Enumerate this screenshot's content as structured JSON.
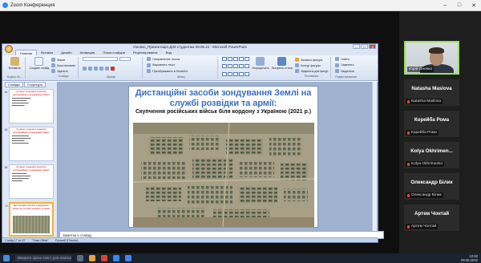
{
  "zoom": {
    "window_title": "Zoom Конференция"
  },
  "ppt": {
    "title": "Онопко_Презентація ДЗЗ студентам 09.06.22 - Microsoft PowerPoint",
    "tabs": [
      "Главная",
      "Вставка",
      "Дизайн",
      "Анимация",
      "Показ слайдов",
      "Рецензирование",
      "Вид"
    ],
    "ribbon": {
      "paste": "Вставить",
      "new_slide": "Создать слайд",
      "layout": "Макет",
      "reset": "Восстановить",
      "delete": "Удалить",
      "clipboard": "Буфер об...",
      "slides": "Слайды",
      "font": "Шрифт",
      "paragraph": "Абзац",
      "text_direction": "Направление текста",
      "align_text": "Выровнять текст",
      "smartart": "Преобразовать в SmartArt",
      "arrange": "Упорядочить",
      "quick_styles": "Экспресс-стили",
      "shape_fill": "Заливка фигуры",
      "shape_outline": "Контур фигуры",
      "shape_effects": "Эффекты для фигур",
      "drawing": "Рисование",
      "find": "Найти",
      "replace": "Заменить",
      "select": "Выделить",
      "editing": "Редактирование"
    },
    "pane_tabs": [
      "Слайды",
      "Структура"
    ],
    "thumbs": [
      {
        "num": "14",
        "title": "Сучасні тенденції розвитку дистанційного зондування Землі"
      },
      {
        "num": "15",
        "title": "Сучасні тенденції розвитку дистанційного зондування Землі"
      },
      {
        "num": "16",
        "title": "Сучасні тенденції розвитку дистанційного зондування Землі"
      },
      {
        "num": "17",
        "title": "Дистанційні засоби зондування Землі на службі розвідки та армії"
      }
    ],
    "slide": {
      "title": "Дистанційні засоби зондування Землі на службі розвідки та армії:",
      "subtitle": "Скупчення російських військ біля кордону з Україною (2021 р.)"
    },
    "notes": "Заметки к слайду",
    "status": {
      "slide": "Слайд 17 из 57",
      "theme": "\"Тема Office\"",
      "lang": "Русский (Россия)"
    }
  },
  "participants": {
    "active_speaker": "Юрій Онопко",
    "tiles": [
      {
        "name": "Natasha Maslova",
        "label": "Natasha Maslova"
      },
      {
        "name": "Корейба Рома",
        "label": "Корейба Рома"
      },
      {
        "name": "Kolya Okhrimen...",
        "label": "Kolya Okhrimenko"
      },
      {
        "name": "Олександр Білик",
        "label": "Олександр Білик"
      },
      {
        "name": "Артем Чонтай",
        "label": "Артем Чонтай"
      }
    ]
  },
  "taskbar": {
    "search": "Введите здесь текст для поиска",
    "time": "10:50",
    "date": "09.06.2022"
  }
}
